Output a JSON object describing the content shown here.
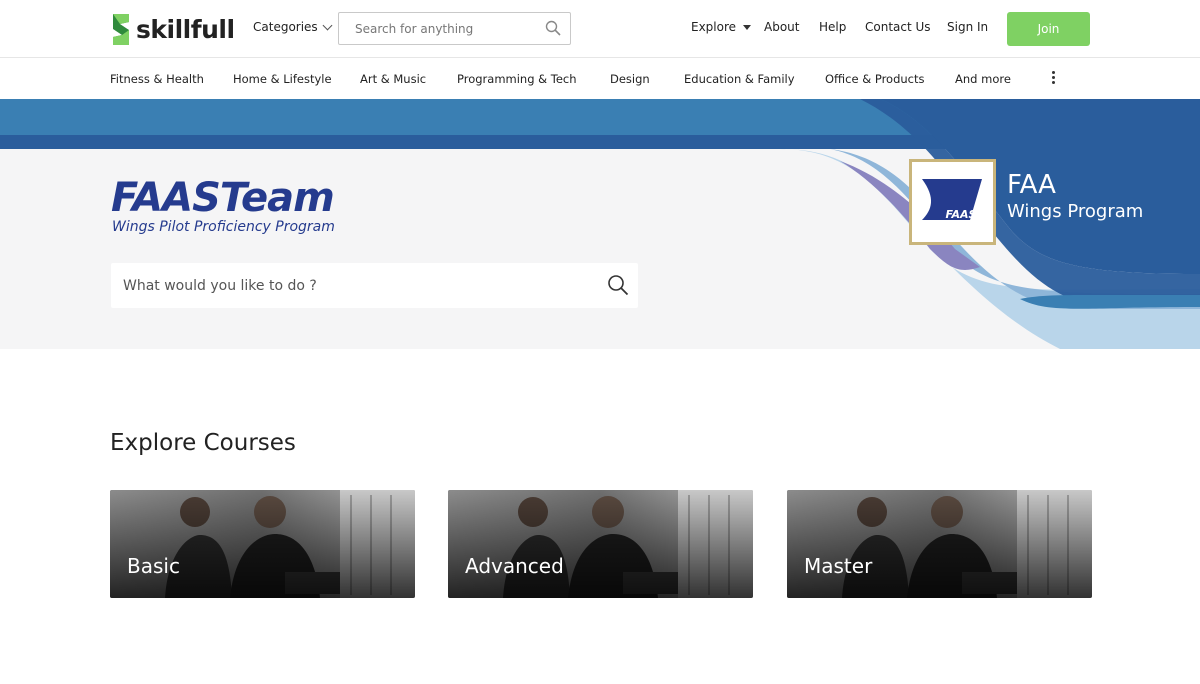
{
  "header": {
    "logo_text": "skillfull",
    "categories_label": "Categories",
    "search_placeholder": "Search for anything",
    "nav": {
      "explore": "Explore",
      "about": "About",
      "help": "Help",
      "contact": "Contact Us",
      "signin": "Sign In",
      "join": "Join"
    },
    "accent_color": "#7fd163"
  },
  "category_bar": {
    "items": [
      "Fitness & Health",
      "Home & Lifestyle",
      "Art & Music",
      "Programming & Tech",
      "Design",
      "Education & Family",
      "Office & Products",
      "And more"
    ]
  },
  "hero": {
    "brand_title": "FAASTeam",
    "brand_subtitle": "Wings Pilot Proficiency Program",
    "search_placeholder": "What would you like to do ?",
    "badge_logo_text": "FAAST",
    "badge_line1": "FAA",
    "badge_line2": "Wings Program",
    "brand_color": "#253b8e"
  },
  "courses": {
    "title": "Explore Courses",
    "cards": [
      "Basic",
      "Advanced",
      "Master"
    ]
  }
}
